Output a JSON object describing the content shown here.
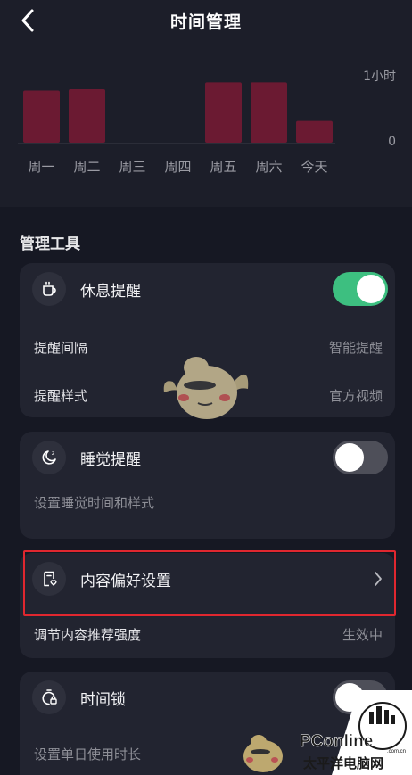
{
  "header": {
    "title": "时间管理"
  },
  "chart_data": {
    "type": "bar",
    "categories": [
      "周一",
      "周二",
      "周三",
      "周四",
      "周五",
      "周六",
      "今天"
    ],
    "values": [
      0.77,
      0.79,
      0,
      0,
      0.89,
      0.89,
      0.32
    ],
    "y_tick_labels": [
      "1小时",
      "0"
    ],
    "ylim": [
      0,
      1
    ],
    "bar_color": "#6b1a32"
  },
  "section_title": "管理工具",
  "rest_reminder": {
    "label": "休息提醒",
    "enabled": true,
    "rows": [
      {
        "label": "提醒间隔",
        "value": "智能提醒"
      },
      {
        "label": "提醒样式",
        "value": "官方视频"
      }
    ]
  },
  "sleep_reminder": {
    "label": "睡觉提醒",
    "enabled": false,
    "description": "设置睡觉时间和样式"
  },
  "content_preference": {
    "label": "内容偏好设置",
    "row": {
      "label": "调节内容推荐强度",
      "value": "生效中"
    }
  },
  "time_lock": {
    "label": "时间锁",
    "enabled": false,
    "description": "设置单日使用时长"
  },
  "watermark": {
    "text_main": "PConline",
    "text_sub": "太平洋电脑网",
    "text_tiny": ".com.cn"
  },
  "colors": {
    "accent_green": "#3dbf80",
    "highlight_red": "#e0272f"
  },
  "icons": [
    "back-arrow-icon",
    "cup-icon",
    "moon-icon",
    "document-heart-icon",
    "timer-lock-icon",
    "chevron-right-icon"
  ]
}
